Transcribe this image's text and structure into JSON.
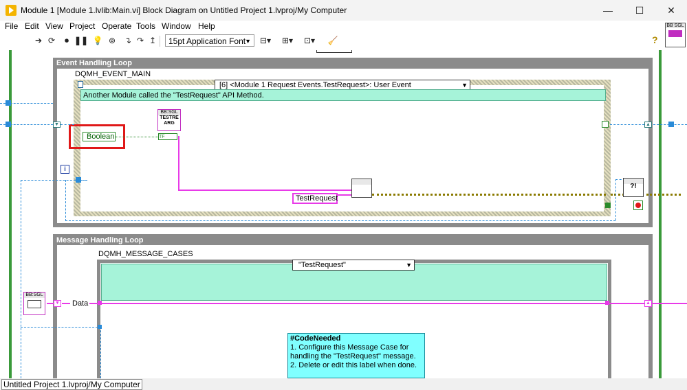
{
  "window": {
    "title": "Module 1 [Module 1.lvlib:Main.vi] Block Diagram on Untitled Project 1.lvproj/My Computer",
    "minimize": "—",
    "maximize": "☐",
    "close": "✕"
  },
  "menu": [
    "File",
    "Edit",
    "View",
    "Project",
    "Operate",
    "Tools",
    "Window",
    "Help"
  ],
  "toolbar": {
    "font": "15pt Application Font"
  },
  "vi_icon_label": "BB SGL",
  "event_loop": {
    "label": "Event Handling Loop",
    "structure_label": "DQMH_EVENT_MAIN",
    "case_selector": "[6] <Module 1 Request Events.TestRequest>: User Event",
    "comment": "Another Module called the \"TestRequest\" API Method.",
    "boolean_label": "Boolean",
    "arg_node_text": "TESTRE ARG",
    "arg_node_header": "BB:SGL",
    "tf_text": "TF",
    "string_const": "TestRequest",
    "info_icon": "i"
  },
  "message_loop": {
    "label": "Message Handling Loop",
    "structure_label": "DQMH_MESSAGE_CASES",
    "case_selector": "\"TestRequest\"",
    "data_label": "Data",
    "node_header": "BB:SGL",
    "code_needed_title": "#CodeNeeded",
    "code_needed_lines": [
      "1. Configure this Message Case for",
      "handling the \"TestRequest\" message.",
      "2. Delete or edit this label when done."
    ]
  },
  "status": "Untitled Project 1.lvproj/My Computer"
}
